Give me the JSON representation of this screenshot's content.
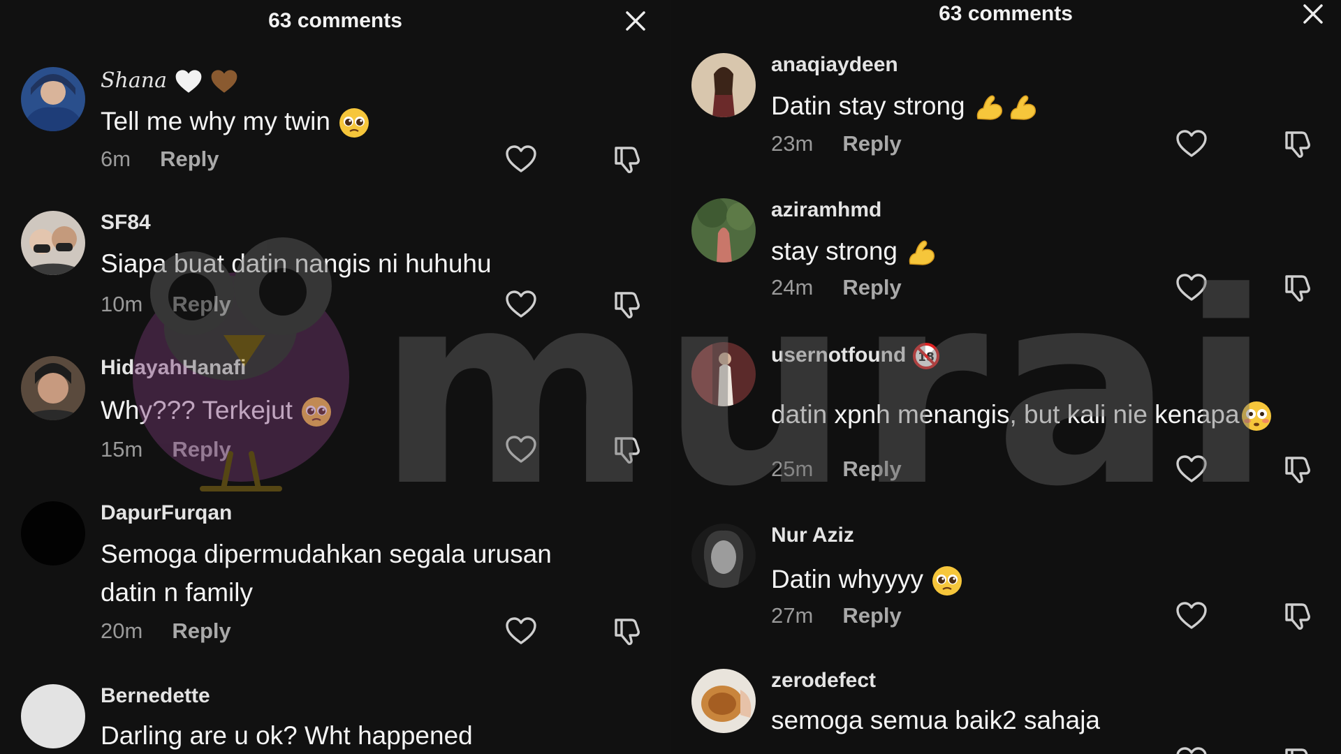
{
  "left_panel": {
    "header_title": "63 comments",
    "comments": [
      {
        "username": "Shana",
        "text": "Tell me why my twin",
        "time": "6m",
        "reply": "Reply"
      },
      {
        "username": "SF84",
        "text": "Siapa buat datin nangis ni huhuhu",
        "time": "10m",
        "reply": "Reply"
      },
      {
        "username": "HidayahHanafi",
        "text": "Why??? Terkejut",
        "time": "15m",
        "reply": "Reply"
      },
      {
        "username": "DapurFurqan",
        "text": "Semoga dipermudahkan segala urusan datin n family",
        "time": "20m",
        "reply": "Reply"
      },
      {
        "username": "Bernedette",
        "text": "Darling are u ok? Wht happened",
        "time": "",
        "reply": ""
      }
    ]
  },
  "right_panel": {
    "header_title": "63 comments",
    "comments": [
      {
        "username": "anaqiaydeen",
        "text": "Datin stay strong",
        "time": "23m",
        "reply": "Reply"
      },
      {
        "username": "aziramhmd",
        "text": "stay strong",
        "time": "24m",
        "reply": "Reply"
      },
      {
        "username": "usernotfound",
        "text": "datin xpnh menangis, but kali nie kenapa",
        "time": "25m",
        "reply": "Reply"
      },
      {
        "username": "Nur Aziz",
        "text": "Datin whyyyy",
        "time": "27m",
        "reply": "Reply"
      },
      {
        "username": "zerodefect",
        "text": "semoga semua baik2 sahaja",
        "time": "",
        "reply": ""
      }
    ]
  },
  "watermark": {
    "text": "murai"
  },
  "colors": {
    "background": "#111111",
    "username": "#e4e4e4",
    "comment_text": "#f4f4f4",
    "meta": "#9a9a9a",
    "watermark": "#6a6a6a",
    "heart_icon_color": "#cfcfcf"
  },
  "icons": {
    "close": "close-icon",
    "like": "heart-outline-icon",
    "dislike": "thumbs-down-icon",
    "emoji_pleading": "pleading-face-emoji-icon",
    "emoji_muscle": "flexed-biceps-emoji-icon",
    "emoji_flushed": "flushed-face-emoji-icon",
    "badge_18": "no-under-18-badge-icon",
    "heart_white": "white-heart-emoji-icon",
    "heart_brown": "brown-heart-emoji-icon"
  }
}
